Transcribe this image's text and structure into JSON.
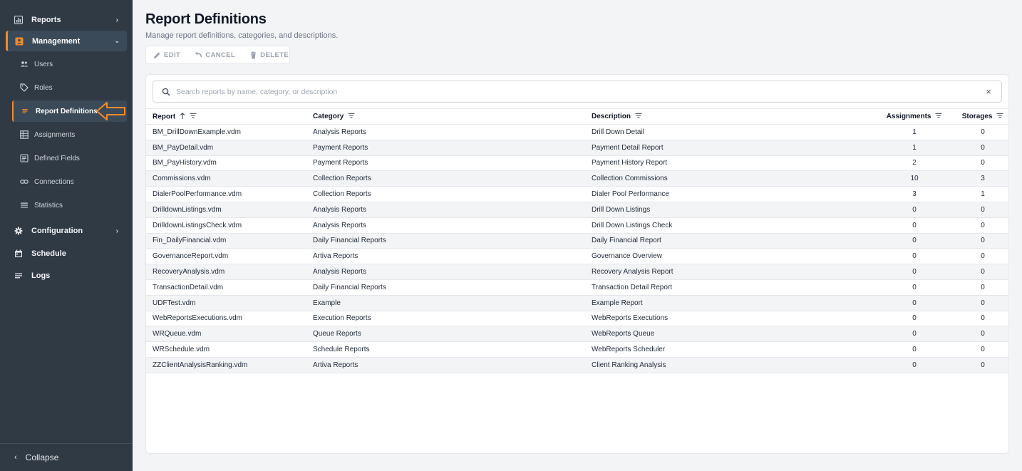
{
  "sidebar": {
    "reports_label": "Reports",
    "management_label": "Management",
    "items": [
      {
        "label": "Users"
      },
      {
        "label": "Roles"
      },
      {
        "label": "Report Definitions"
      },
      {
        "label": "Assignments"
      },
      {
        "label": "Defined Fields"
      },
      {
        "label": "Connections"
      },
      {
        "label": "Statistics"
      }
    ],
    "configuration_label": "Configuration",
    "schedule_label": "Schedule",
    "logs_label": "Logs",
    "collapse_label": "Collapse"
  },
  "header": {
    "title": "Report Definitions",
    "subtitle": "Manage report definitions, categories, and descriptions."
  },
  "toolbar": {
    "edit_label": "EDIT",
    "cancel_label": "CANCEL",
    "delete_label": "DELETE"
  },
  "search": {
    "placeholder": "Search reports by name, category, or description",
    "clear_glyph": "×"
  },
  "table": {
    "columns": {
      "report": "Report",
      "category": "Category",
      "description": "Description",
      "assignments": "Assignments",
      "storages": "Storages"
    },
    "rows": [
      {
        "report": "BM_DrillDownExample.vdm",
        "category": "Analysis Reports",
        "description": "Drill Down Detail",
        "assignments": "1",
        "storages": "0"
      },
      {
        "report": "BM_PayDetail.vdm",
        "category": "Payment Reports",
        "description": "Payment Detail Report",
        "assignments": "1",
        "storages": "0"
      },
      {
        "report": "BM_PayHistory.vdm",
        "category": "Payment Reports",
        "description": "Payment History Report",
        "assignments": "2",
        "storages": "0"
      },
      {
        "report": "Commissions.vdm",
        "category": "Collection Reports",
        "description": "Collection Commissions",
        "assignments": "10",
        "storages": "3"
      },
      {
        "report": "DialerPoolPerformance.vdm",
        "category": "Collection Reports",
        "description": "Dialer Pool Performance",
        "assignments": "3",
        "storages": "1"
      },
      {
        "report": "DrilldownListings.vdm",
        "category": "Analysis Reports",
        "description": "Drill Down Listings",
        "assignments": "0",
        "storages": "0"
      },
      {
        "report": "DrilldownListingsCheck.vdm",
        "category": "Analysis Reports",
        "description": "Drill Down Listings Check",
        "assignments": "0",
        "storages": "0"
      },
      {
        "report": "Fin_DailyFinancial.vdm",
        "category": "Daily Financial Reports",
        "description": "Daily Financial Report",
        "assignments": "0",
        "storages": "0"
      },
      {
        "report": "GovernanceReport.vdm",
        "category": "Artiva Reports",
        "description": "Governance Overview",
        "assignments": "0",
        "storages": "0"
      },
      {
        "report": "RecoveryAnalysis.vdm",
        "category": "Analysis Reports",
        "description": "Recovery Analysis Report",
        "assignments": "0",
        "storages": "0"
      },
      {
        "report": "TransactionDetail.vdm",
        "category": "Daily Financial Reports",
        "description": "Transaction Detail Report",
        "assignments": "0",
        "storages": "0"
      },
      {
        "report": "UDFTest.vdm",
        "category": "Example",
        "description": "Example Report",
        "assignments": "0",
        "storages": "0"
      },
      {
        "report": "WebReportsExecutions.vdm",
        "category": "Execution Reports",
        "description": "WebReports Executions",
        "assignments": "0",
        "storages": "0"
      },
      {
        "report": "WRQueue.vdm",
        "category": "Queue Reports",
        "description": "WebReports Queue",
        "assignments": "0",
        "storages": "0"
      },
      {
        "report": "WRSchedule.vdm",
        "category": "Schedule Reports",
        "description": "WebReports Scheduler",
        "assignments": "0",
        "storages": "0"
      },
      {
        "report": "ZZClientAnalysisRanking.vdm",
        "category": "Artiva Reports",
        "description": "Client Ranking Analysis",
        "assignments": "0",
        "storages": "0"
      }
    ]
  },
  "colors": {
    "sidebar_bg": "#2f3a45",
    "accent": "#f28a2e",
    "page_bg": "#f3f4f6"
  }
}
